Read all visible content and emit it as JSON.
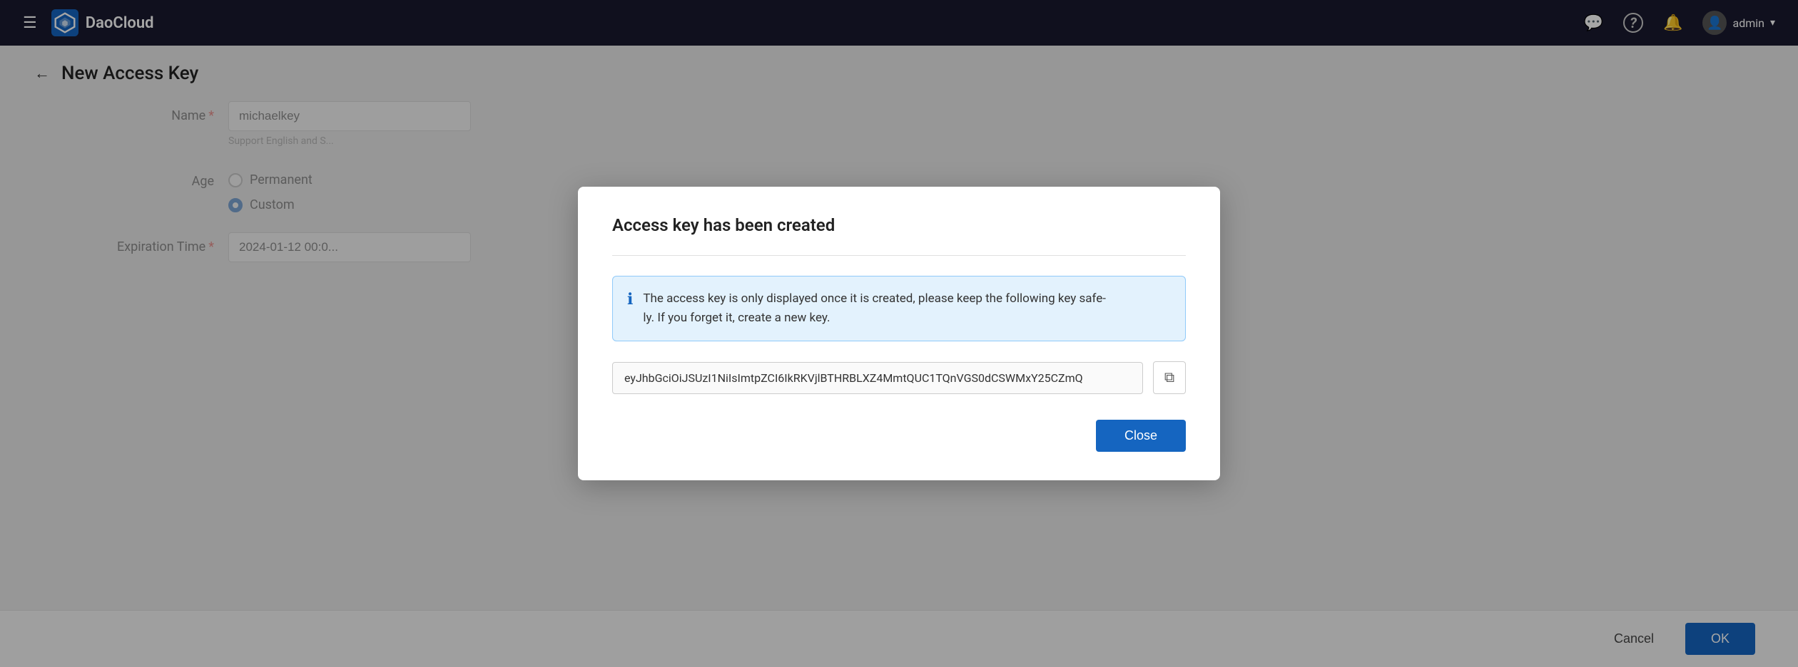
{
  "navbar": {
    "hamburger_label": "☰",
    "logo_text": "DaoCloud",
    "chat_icon": "💬",
    "help_icon": "?",
    "bell_icon": "🔔",
    "user_name": "admin",
    "chevron": "▾"
  },
  "page": {
    "back_label": "←",
    "title": "New Access Key"
  },
  "form": {
    "name_label": "Name",
    "name_value": "michaelkey",
    "name_hint": "Support English and S...",
    "age_label": "Age",
    "permanent_label": "Permanent",
    "custom_label": "Custom",
    "expiration_label": "Expiration Time",
    "expiration_value": "2024-01-12 00:0..."
  },
  "bottom": {
    "cancel_label": "Cancel",
    "ok_label": "OK"
  },
  "modal": {
    "title": "Access key has been created",
    "info_text": "The access key is only displayed once it is created, please keep the following key safe-\nly. If you forget it, create a new key.",
    "key_value": "eyJhbGciOiJSUzI1NiIsImtpZCI6IkRKVjlBTHRBLXZ4MmtQUC1TQnVGS0dCSWMxY25CZmQ",
    "copy_icon": "⧉",
    "close_label": "Close"
  }
}
